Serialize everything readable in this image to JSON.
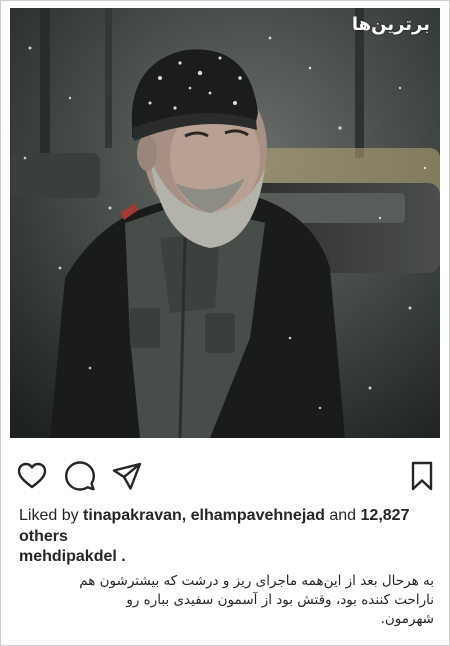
{
  "post": {
    "watermark": "برترین‌ها",
    "likes": {
      "prefix": "Liked by ",
      "user1": "tinapakravan",
      "sep": ", ",
      "user2": "elhampavehnejad",
      "and": " and ",
      "others": "12,827 others"
    },
    "caption": {
      "username": "mehdipakdel",
      "suffix": " .",
      "lines": [
        "به هرحال بعد از این‌همه ماجرای ریز و درشت که بیشترشون هم",
        "ناراحت کننده بود، وقتش بود از آسمون سفیدی بباره رو",
        "شهرمون."
      ]
    }
  },
  "icons": {
    "like": "heart-outline-icon",
    "comment": "speech-bubble-icon",
    "share": "paper-plane-icon",
    "save": "bookmark-icon"
  }
}
